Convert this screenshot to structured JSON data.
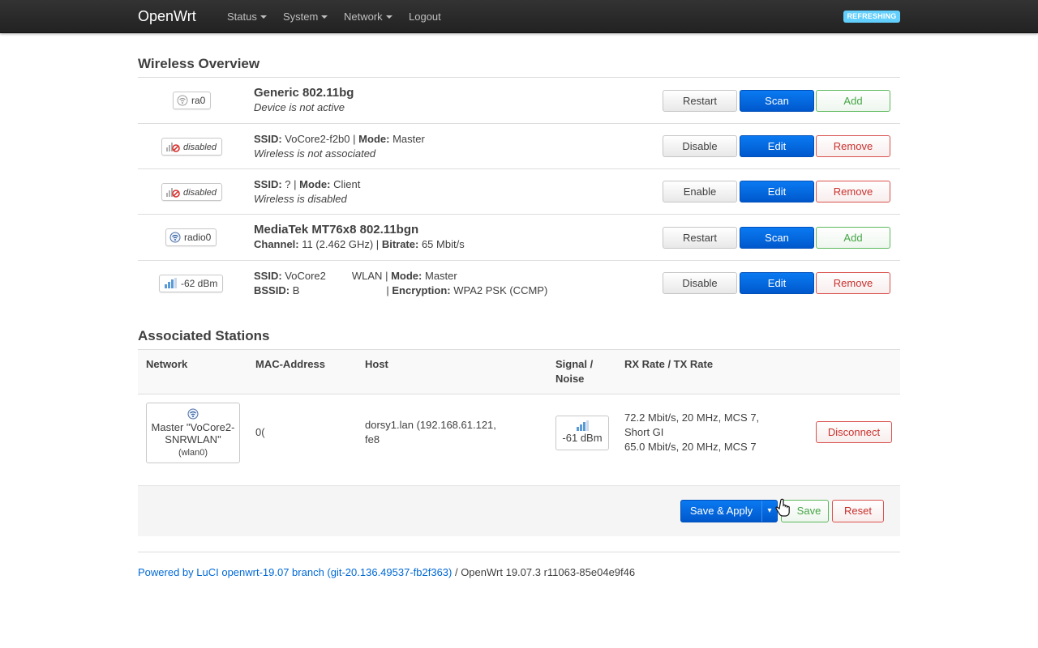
{
  "navbar": {
    "brand": "OpenWrt",
    "menus": [
      {
        "label": "Status",
        "has_caret": true
      },
      {
        "label": "System",
        "has_caret": true
      },
      {
        "label": "Network",
        "has_caret": true
      },
      {
        "label": "Logout",
        "has_caret": false
      }
    ],
    "badge": "REFRESHING"
  },
  "wireless": {
    "title": "Wireless Overview",
    "rows": [
      {
        "badge": "ra0",
        "badge_icon": "wifi-inactive-icon",
        "title": "Generic 802.11bg",
        "subtitle": "Device is not active",
        "buttons": [
          "Restart",
          "Scan",
          "Add"
        ]
      },
      {
        "badge": "disabled",
        "badge_icon": "wifi-disabled-icon",
        "ssid_label": "SSID:",
        "ssid": "VoCore2-f2b0",
        "sep": "|",
        "mode_label": "Mode:",
        "mode": "Master",
        "subtitle": "Wireless is not associated",
        "buttons": [
          "Disable",
          "Edit",
          "Remove"
        ]
      },
      {
        "badge": "disabled",
        "badge_icon": "wifi-disabled-icon",
        "ssid_label": "SSID:",
        "ssid": "?",
        "sep": "|",
        "mode_label": "Mode:",
        "mode": "Client",
        "subtitle": "Wireless is disabled",
        "buttons": [
          "Enable",
          "Edit",
          "Remove"
        ]
      },
      {
        "badge": "radio0",
        "badge_icon": "wifi-active-icon",
        "title": "MediaTek MT76x8 802.11bgn",
        "channel_label": "Channel:",
        "channel": "11 (2.462 GHz)",
        "sep": "|",
        "bitrate_label": "Bitrate:",
        "bitrate": "65 Mbit/s",
        "buttons": [
          "Restart",
          "Scan",
          "Add"
        ]
      },
      {
        "badge": "-62 dBm",
        "badge_icon": "signal-strength-icon",
        "ssid_label": "SSID:",
        "ssid_start": "VoCore2",
        "ssid_end": "WLAN",
        "sep": "|",
        "mode_label": "Mode:",
        "mode": "Master",
        "bssid_label": "BSSID:",
        "bssid": "B",
        "encryption_label": "Encryption:",
        "encryption": "WPA2 PSK (CCMP)",
        "buttons": [
          "Disable",
          "Edit",
          "Remove"
        ]
      }
    ]
  },
  "stations": {
    "title": "Associated Stations",
    "headers": [
      "Network",
      "MAC-Address",
      "Host",
      "Signal /",
      "Noise",
      "RX Rate / TX Rate"
    ],
    "row": {
      "network_line1": "Master \"VoCore2-",
      "network_line2": "SNRWLAN\"",
      "network_iface": "(wlan0)",
      "mac": "0(",
      "host_line1": "dorsy1.lan (192.168.61.121,",
      "host_line2": "fe8",
      "signal": "-61 dBm",
      "rx_line1": "72.2 Mbit/s, 20 MHz, MCS 7,",
      "rx_line2": "Short GI",
      "tx_line": "65.0 Mbit/s, 20 MHz, MCS 7",
      "action": "Disconnect"
    }
  },
  "actions": {
    "save_apply": "Save & Apply",
    "dropdown": "▾",
    "save": "Save",
    "reset": "Reset"
  },
  "footer": {
    "link": "Powered by LuCI openwrt-19.07 branch (git-20.136.49537-fb2f363)",
    "rest": " / OpenWrt 19.07.3 r11063-85e04e9f46"
  }
}
